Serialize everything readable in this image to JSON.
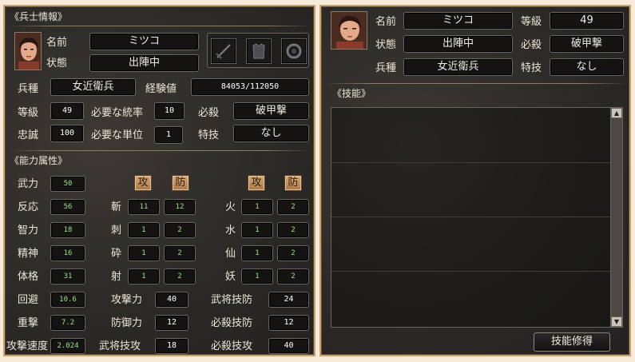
{
  "soldier_info": {
    "section_title": "《兵士情報》",
    "name_label": "名前",
    "name": "ミツコ",
    "status_label": "状態",
    "status": "出陣中",
    "unit_type_label": "兵種",
    "unit_type": "女近衛兵",
    "exp_label": "経験値",
    "exp": "84053/112050",
    "level_label": "等級",
    "level": "49",
    "req_command_label": "必要な統率",
    "req_command": "10",
    "special_label": "必殺",
    "special": "破甲撃",
    "loyalty_label": "忠誠",
    "loyalty": "100",
    "req_units_label": "必要な単位",
    "req_units": "1",
    "skill_label": "特技",
    "skill": "なし",
    "equipment_icons": [
      "sword-icon",
      "armor-icon",
      "ring-icon"
    ]
  },
  "attributes": {
    "section_title": "《能力属性》",
    "atk_header": "攻",
    "def_header": "防",
    "stats": [
      {
        "label": "武力",
        "value": "50"
      },
      {
        "label": "反応",
        "value": "56"
      },
      {
        "label": "智力",
        "value": "18"
      },
      {
        "label": "精神",
        "value": "16"
      },
      {
        "label": "体格",
        "value": "31"
      },
      {
        "label": "回避",
        "value": "10.6"
      },
      {
        "label": "重撃",
        "value": "7.2"
      },
      {
        "label": "攻撃速度",
        "value": "2.024"
      }
    ],
    "physical": [
      {
        "label": "斬",
        "atk": "11",
        "def": "12"
      },
      {
        "label": "刺",
        "atk": "1",
        "def": "2"
      },
      {
        "label": "砕",
        "atk": "1",
        "def": "2"
      },
      {
        "label": "射",
        "atk": "1",
        "def": "2"
      }
    ],
    "elemental": [
      {
        "label": "火",
        "atk": "1",
        "def": "2"
      },
      {
        "label": "水",
        "atk": "1",
        "def": "2"
      },
      {
        "label": "仙",
        "atk": "1",
        "def": "2"
      },
      {
        "label": "妖",
        "atk": "1",
        "def": "2"
      }
    ],
    "combat": [
      {
        "label": "攻撃力",
        "value": "40"
      },
      {
        "label": "防御力",
        "value": "12"
      },
      {
        "label": "武将技攻",
        "value": "18"
      }
    ],
    "combat2": [
      {
        "label": "武将技防",
        "value": "24"
      },
      {
        "label": "必殺技防",
        "value": "12"
      },
      {
        "label": "必殺技攻",
        "value": "40"
      }
    ]
  },
  "right_panel": {
    "name_label": "名前",
    "name": "ミツコ",
    "level_label": "等級",
    "level": "49",
    "status_label": "状態",
    "status": "出陣中",
    "special_label": "必殺",
    "special": "破甲撃",
    "unit_type_label": "兵種",
    "unit_type": "女近衛兵",
    "skill_label": "特技",
    "skill": "なし",
    "skills_title": "《技能》",
    "learn_button": "技能修得",
    "scroll_up": "▲",
    "scroll_down": "▼"
  },
  "colors": {
    "frame": "#c9a36e",
    "panel_bg": "#2c2a27",
    "stat_green": "#9fe08a",
    "atk_def_button": "#c08a58"
  }
}
